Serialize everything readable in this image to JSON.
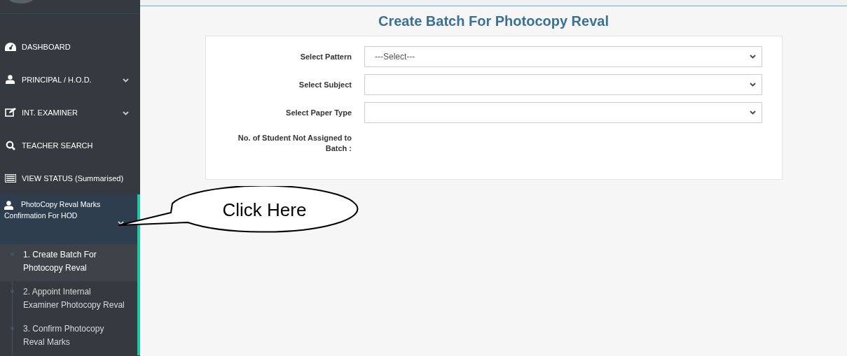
{
  "sidebar": {
    "items": [
      {
        "label": "DASHBOARD",
        "kind": "link"
      },
      {
        "label": "PRINCIPAL / H.O.D.",
        "kind": "group",
        "expanded": false
      },
      {
        "label": "INT. EXAMINER",
        "kind": "group",
        "expanded": false
      },
      {
        "label": "TEACHER SEARCH",
        "kind": "link"
      },
      {
        "label": "VIEW STATUS (Summarised)",
        "kind": "link"
      },
      {
        "label": "PhotoCopy Reval Marks Confirmation For HOD",
        "kind": "group",
        "expanded": true,
        "children": [
          {
            "label": "1. Create Batch For Photocopy Reval",
            "selected": true
          },
          {
            "label": "2. Appoint Internal Examiner Photocopy Reval",
            "selected": false
          },
          {
            "label": "3. Confirm Photocopy Reval Marks",
            "selected": false
          }
        ]
      }
    ]
  },
  "page": {
    "title": "Create Batch For Photocopy Reval",
    "fields": [
      {
        "label": "Select Pattern",
        "kind": "select",
        "value": "---Select---"
      },
      {
        "label": "Select Subject",
        "kind": "select"
      },
      {
        "label": "Select Paper Type",
        "kind": "select"
      },
      {
        "label": "No. of Student Not Assigned to Batch :",
        "kind": "readout"
      }
    ]
  },
  "callout": {
    "text": "Click Here"
  }
}
